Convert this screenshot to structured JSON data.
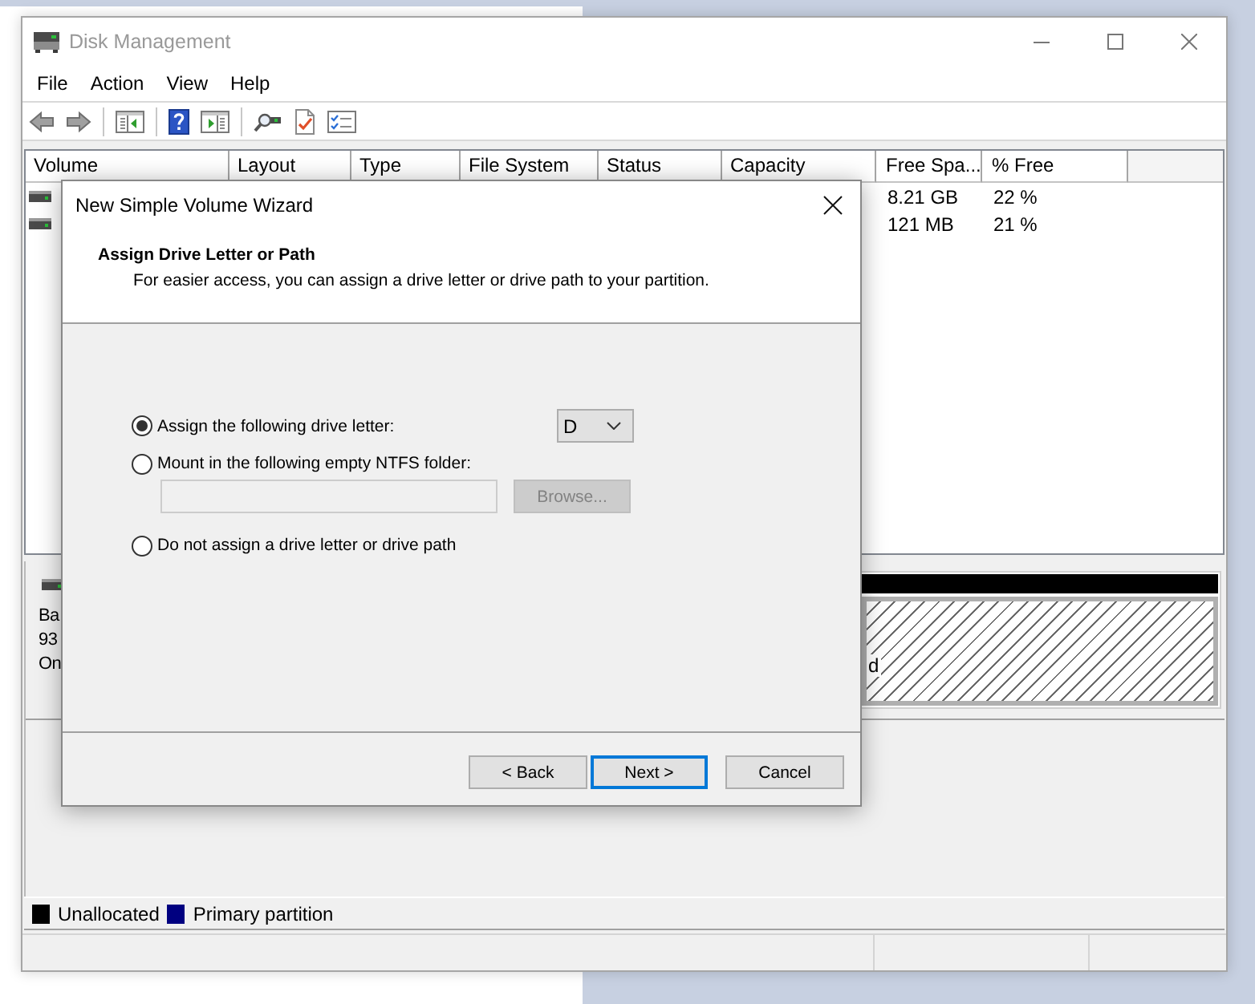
{
  "window": {
    "title": "Disk Management",
    "active": false
  },
  "menu": [
    "File",
    "Action",
    "View",
    "Help"
  ],
  "volume_table": {
    "columns": [
      "Volume",
      "Layout",
      "Type",
      "File System",
      "Status",
      "Capacity",
      "Free Spa...",
      "% Free"
    ],
    "rows": [
      {
        "free_space": "8.21 GB",
        "percent_free": "22 %"
      },
      {
        "free_space": "121 MB",
        "percent_free": "21 %"
      }
    ]
  },
  "disk_map": {
    "disk": {
      "lines": [
        "Ba",
        "93",
        "On"
      ]
    },
    "partitions": [
      {
        "kind": "unallocated",
        "label": "d",
        "color": "#000000"
      }
    ]
  },
  "legend": [
    {
      "label": "Unallocated",
      "color": "#000000"
    },
    {
      "label": "Primary partition",
      "color": "#000080"
    }
  ],
  "dialog": {
    "title": "New Simple Volume Wizard",
    "heading": "Assign Drive Letter or Path",
    "description": "For easier access, you can assign a drive letter or drive path to your partition.",
    "options": [
      {
        "kind": "drive_letter",
        "label": "Assign the following drive letter:",
        "selected": true,
        "value": "D"
      },
      {
        "kind": "folder",
        "label": "Mount in the following empty NTFS folder:",
        "selected": false,
        "field_disabled": true,
        "button": {
          "label": "Browse...",
          "disabled": true
        }
      },
      {
        "kind": "none",
        "label": "Do not assign a drive letter or drive path",
        "selected": false
      }
    ],
    "buttons": [
      {
        "label": "< Back",
        "focused": false
      },
      {
        "label": "Next >",
        "focused": true
      },
      {
        "label": "Cancel",
        "focused": false
      }
    ]
  }
}
